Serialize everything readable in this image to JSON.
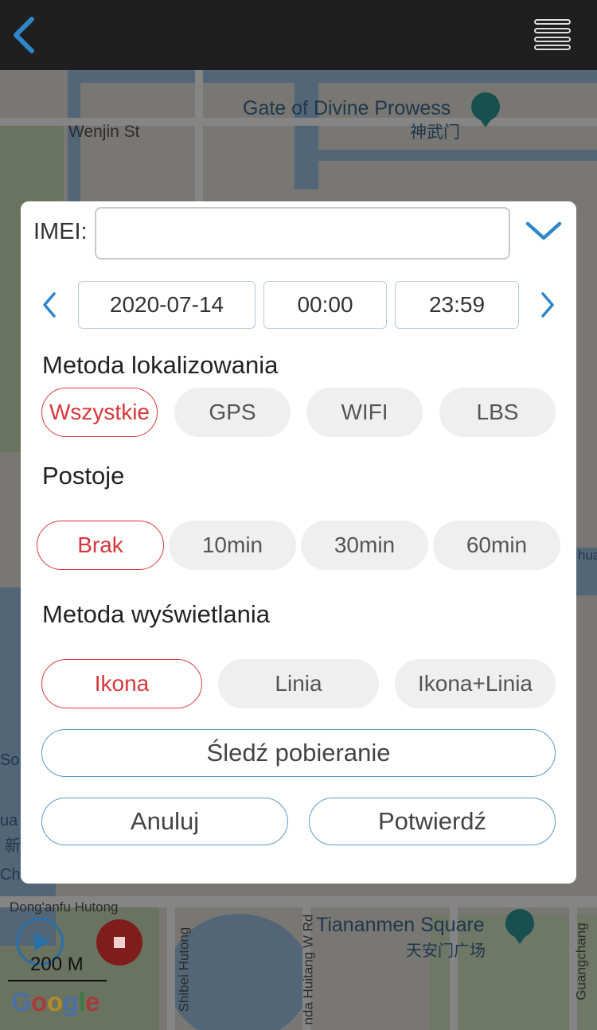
{
  "map": {
    "labels": {
      "gate_en": "Gate of Divine Prowess",
      "gate_zh": "神武门",
      "wenjin": "Wenjin St",
      "dongan": "Dong'anfu Hutong",
      "shibei": "Shibei Hutong",
      "huitang": "nda Huitang W Rd",
      "tiananmen_en": "Tiananmen Square",
      "tiananmen_zh": "天安门广场",
      "guangchang": "Guangchang",
      "left_sou": "Sou",
      "left_ua": "ua",
      "left_xin": "新",
      "left_cha": "Cha",
      "right_hua": "hua"
    },
    "scale": "200 M",
    "attribution": "Google"
  },
  "dialog": {
    "imei_label": "IMEI:",
    "imei_value": "",
    "date": "2020-07-14",
    "time_start": "00:00",
    "time_end": "23:59",
    "locating": {
      "title": "Metoda lokalizowania",
      "options": [
        "Wszystkie",
        "GPS",
        "WIFI",
        "LBS"
      ],
      "selected": "Wszystkie"
    },
    "stops": {
      "title": "Postoje",
      "options": [
        "Brak",
        "10min",
        "30min",
        "60min"
      ],
      "selected": "Brak"
    },
    "display": {
      "title": "Metoda wyświetlania",
      "options": [
        "Ikona",
        "Linia",
        "Ikona+Linia"
      ],
      "selected": "Ikona"
    },
    "track_download": "Śledź pobieranie",
    "cancel": "Anuluj",
    "confirm": "Potwierdź"
  },
  "colors": {
    "accent_blue": "#2f86c8",
    "active_red": "#d7373a",
    "topbar": "#1f1f1f",
    "outline_blue": "#5b9bc2"
  },
  "icons": {
    "back": "chevron-left-icon",
    "menu": "hamburger-menu-icon",
    "dropdown": "chevron-down-icon",
    "prev_day": "chevron-left-icon",
    "next_day": "chevron-right-icon",
    "play": "play-icon",
    "stop": "stop-icon"
  }
}
